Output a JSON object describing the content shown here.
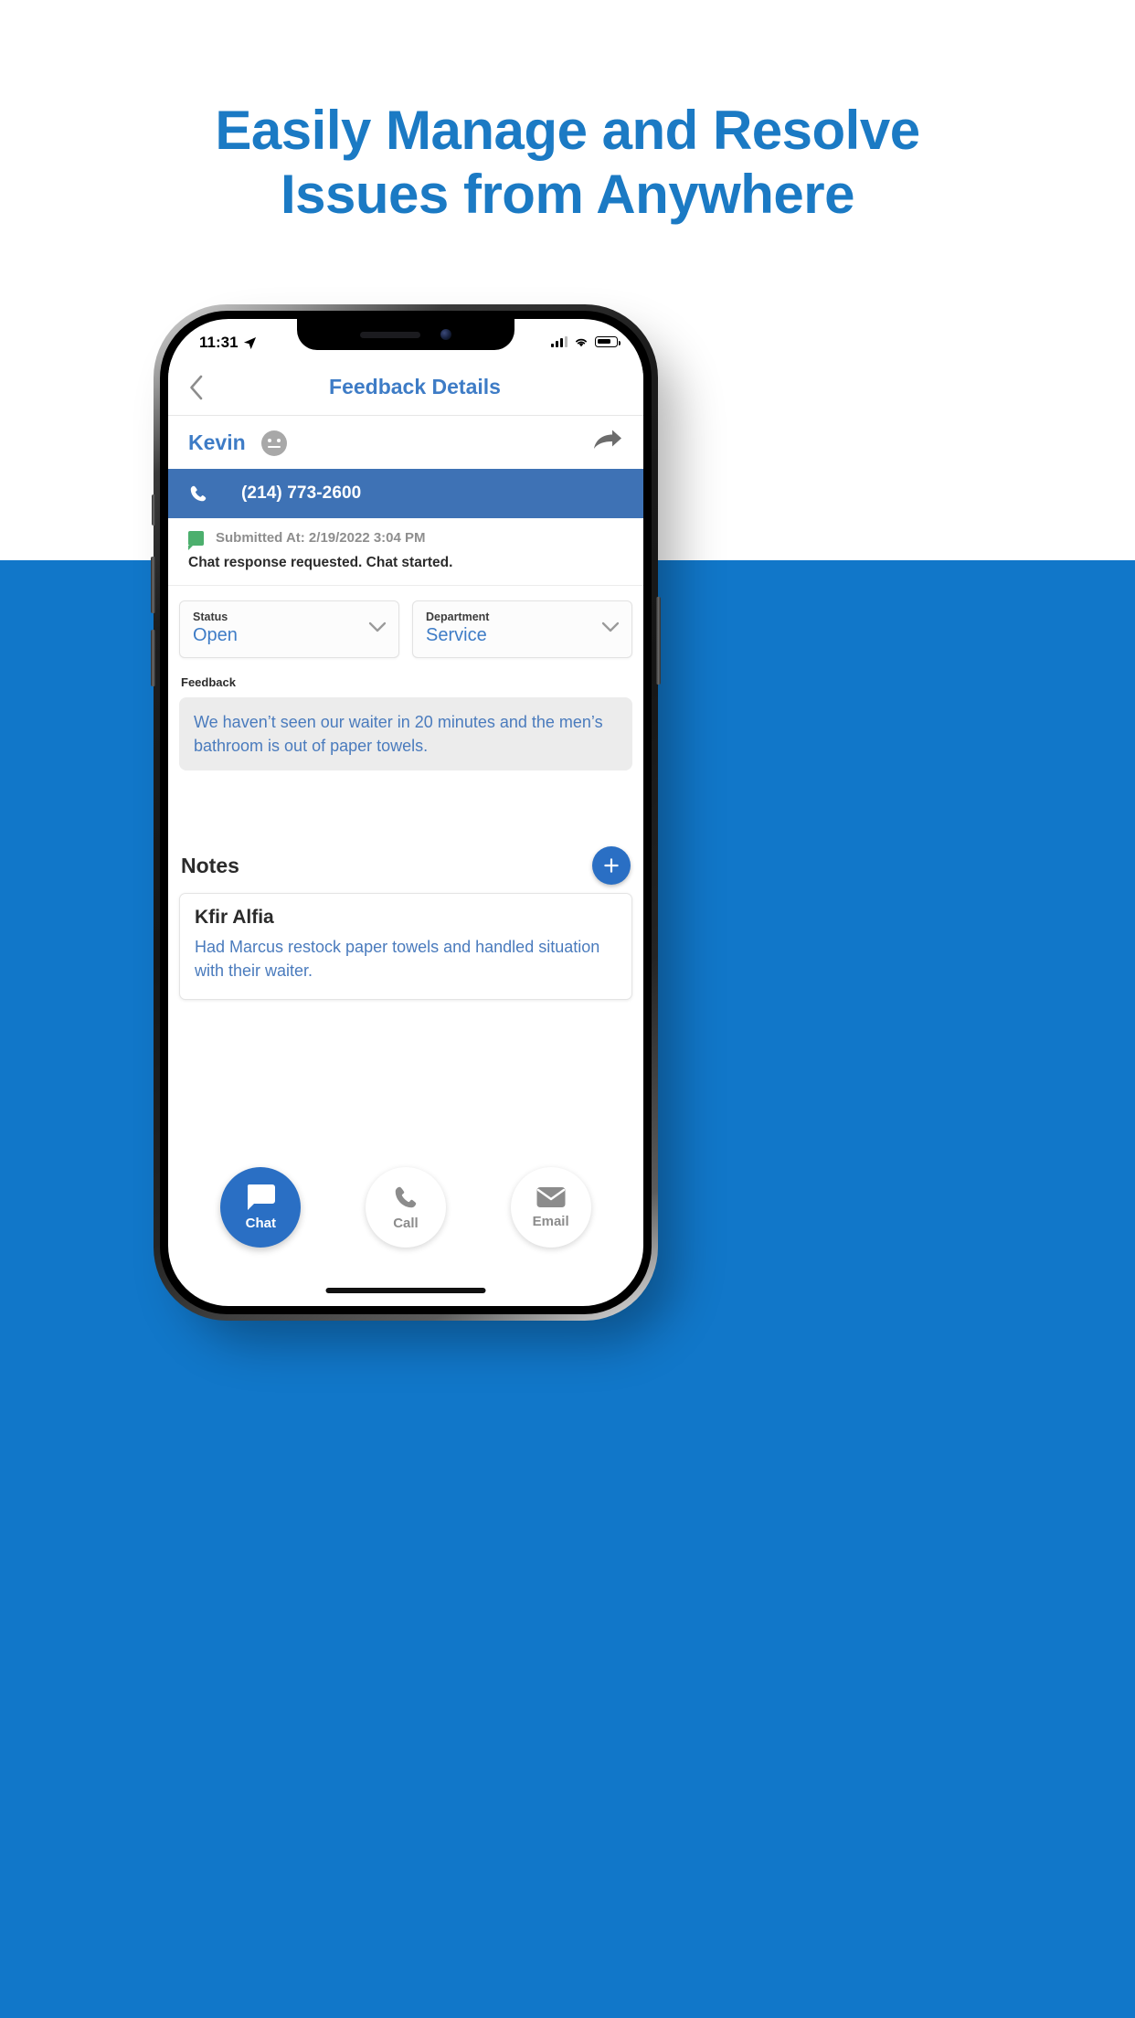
{
  "headline": {
    "line1": "Easily Manage and Resolve",
    "line2": "Issues from Anywhere",
    "color": "#1b7ac4"
  },
  "theme": {
    "background_blue": "#1177c9",
    "accent_blue": "#2a6fc4",
    "link_blue": "#3e7cc6",
    "phone_bar_blue": "#3e72b5",
    "green": "#4caf6d"
  },
  "statusbar": {
    "time": "11:31",
    "location_icon": "location-arrow-icon",
    "signal_icon": "cellular-bars-icon",
    "wifi_icon": "wifi-icon",
    "battery_icon": "battery-icon"
  },
  "navbar": {
    "back_icon": "chevron-left-icon",
    "title": "Feedback Details"
  },
  "contact": {
    "name": "Kevin",
    "mood_icon": "neutral-face-icon",
    "share_icon": "share-arrow-icon",
    "phone_icon": "phone-handset-icon",
    "phone_number": "(214) 773-2600"
  },
  "submitted": {
    "flag_icon": "chat-bubble-icon",
    "label": "Submitted At: 2/19/2022 3:04 PM",
    "status_text": "Chat response requested. Chat started."
  },
  "selects": [
    {
      "label": "Status",
      "value": "Open",
      "chevron_icon": "chevron-down-icon"
    },
    {
      "label": "Department",
      "value": "Service",
      "chevron_icon": "chevron-down-icon"
    }
  ],
  "feedback": {
    "label": "Feedback",
    "text": "We haven’t seen our waiter in 20 minutes and the men’s bathroom is out of paper towels."
  },
  "notes": {
    "title": "Notes",
    "add_label": "+",
    "add_icon": "plus-icon",
    "items": [
      {
        "author": "Kfir Alfia",
        "text": "Had Marcus restock paper towels and handled situation with their waiter."
      }
    ]
  },
  "actions": [
    {
      "label": "Chat",
      "icon": "chat-bubble-icon",
      "style": "primary"
    },
    {
      "label": "Call",
      "icon": "phone-handset-icon",
      "style": "ghost"
    },
    {
      "label": "Email",
      "icon": "envelope-icon",
      "style": "ghost"
    }
  ]
}
